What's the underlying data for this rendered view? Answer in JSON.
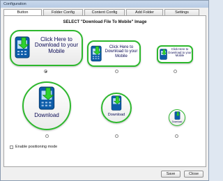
{
  "window": {
    "title": "Configuration"
  },
  "tabs": [
    {
      "label": "Button",
      "active": true
    },
    {
      "label": "Folder Config",
      "active": false
    },
    {
      "label": "Content Config",
      "active": false
    },
    {
      "label": "Add Folder",
      "active": false
    },
    {
      "label": "Settings",
      "active": false
    }
  ],
  "heading": "SELECT \"Download File To Mobile\" Image",
  "options": {
    "rect_label": "Click Here to Download to your Mobile",
    "circle_label": "Download",
    "selected_index": 0
  },
  "positioning": {
    "label": "Enable positioning mode",
    "checked": false
  },
  "footer": {
    "save_label": "Save",
    "close_label": "Close"
  },
  "colors": {
    "accent_green": "#2db82d",
    "phone_blue": "#0d5ca8",
    "arrow_green": "#2fd22f"
  }
}
